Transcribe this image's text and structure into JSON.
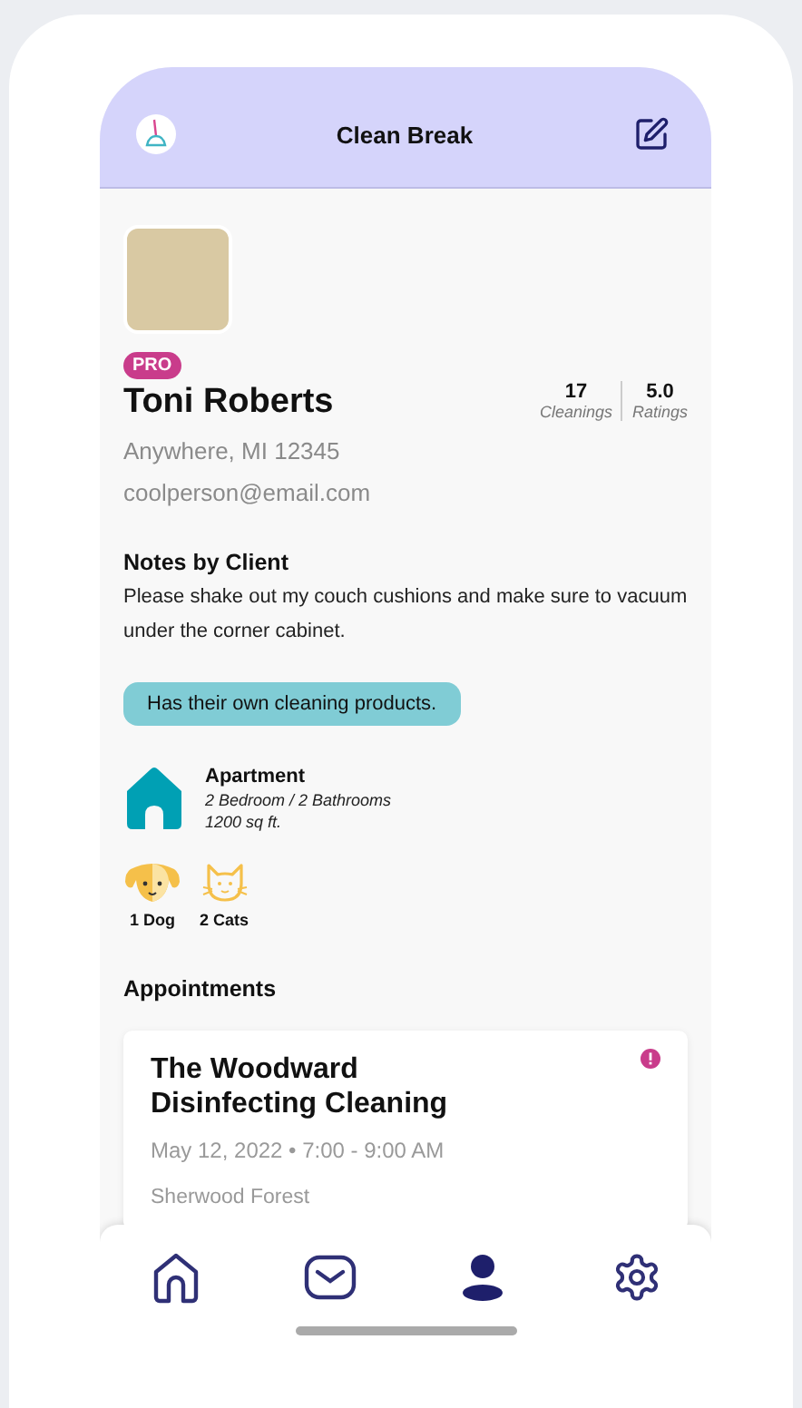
{
  "header": {
    "title": "Clean Break"
  },
  "profile": {
    "badge": "PRO",
    "name": "Toni Roberts",
    "location": "Anywhere, MI 12345",
    "email": "coolperson@email.com",
    "stats": [
      {
        "value": "17",
        "label": "Cleanings"
      },
      {
        "value": "5.0",
        "label": "Ratings"
      }
    ]
  },
  "notes": {
    "heading": "Notes by Client",
    "text": "Please shake out my couch cushions and make sure to vacuum under the corner cabinet.",
    "tag": "Has their own cleaning products."
  },
  "home": {
    "type": "Apartment",
    "rooms": "2 Bedroom / 2 Bathrooms",
    "size": "1200 sq ft."
  },
  "pets": [
    {
      "kind": "dog",
      "label": "1 Dog"
    },
    {
      "kind": "cat",
      "label": "2 Cats"
    }
  ],
  "appointments": {
    "heading": "Appointments",
    "items": [
      {
        "title": "The Woodward Disinfecting Cleaning",
        "when": "May 12, 2022 • 7:00 - 9:00 AM",
        "place": "Sherwood Forest"
      }
    ]
  },
  "nav": [
    {
      "kind": "home",
      "selected": false
    },
    {
      "kind": "mail",
      "selected": false
    },
    {
      "kind": "profile",
      "selected": true
    },
    {
      "kind": "settings",
      "selected": false
    }
  ]
}
